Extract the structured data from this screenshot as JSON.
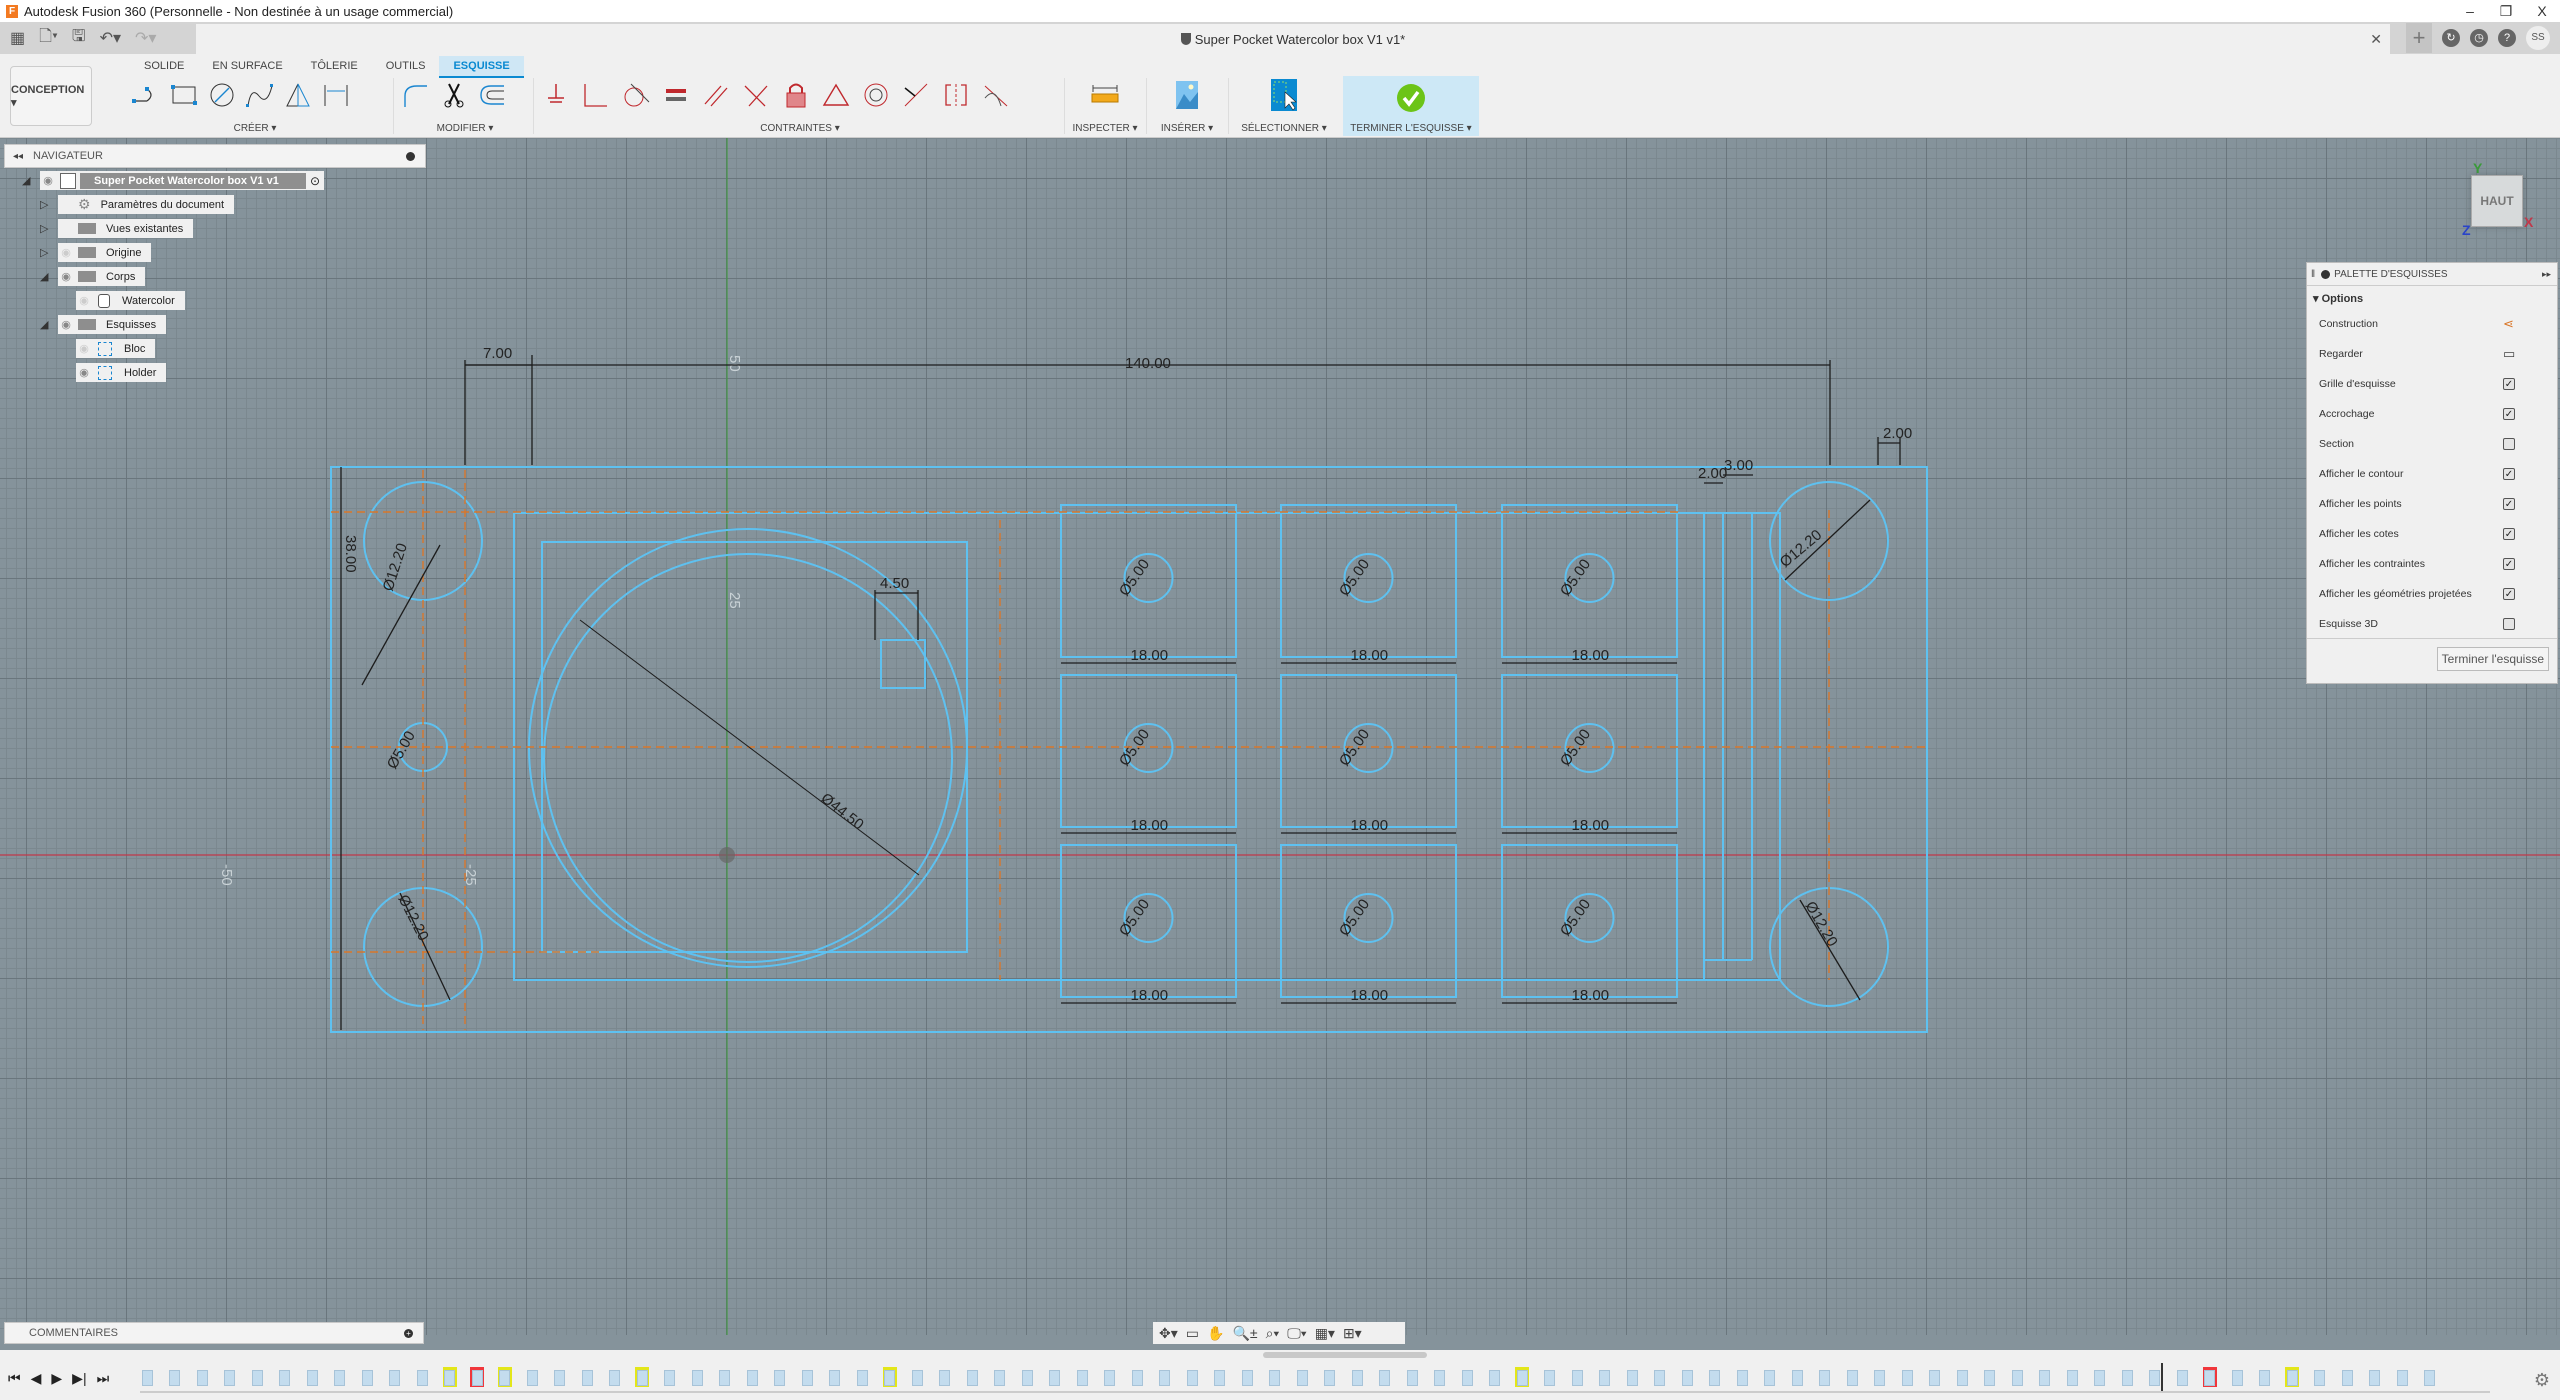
{
  "window": {
    "app_title": "Autodesk Fusion 360 (Personnelle - Non destinée à un usage commercial)",
    "doc_tab_title": "Super Pocket Watercolor box V1 v1*",
    "controls": {
      "minimize": "–",
      "maximize": "❐",
      "close": "X"
    },
    "avatar_initials": "SS"
  },
  "ribbon": {
    "workspace": "CONCEPTION ▾",
    "tabs": [
      {
        "label": "SOLIDE",
        "active": false
      },
      {
        "label": "EN SURFACE",
        "active": false
      },
      {
        "label": "TÔLERIE",
        "active": false
      },
      {
        "label": "OUTILS",
        "active": false
      },
      {
        "label": "ESQUISSE",
        "active": true
      }
    ],
    "groups": {
      "create": "CRÉER ▾",
      "modify": "MODIFIER ▾",
      "constraints": "CONTRAINTES ▾",
      "inspect": "INSPECTER ▾",
      "insert": "INSÉRER ▾",
      "select": "SÉLECTIONNER ▾",
      "finish": "TERMINER L'ESQUISSE ▾"
    }
  },
  "navigator": {
    "title": "NAVIGATEUR",
    "root": "Super Pocket Watercolor box V1 v1",
    "items": [
      {
        "label": "Paramètres du document",
        "level": 1,
        "expand": "collapsed",
        "visible": null,
        "icon": "gear-icon"
      },
      {
        "label": "Vues existantes",
        "level": 1,
        "expand": "collapsed",
        "visible": null,
        "icon": "folder-icon"
      },
      {
        "label": "Origine",
        "level": 1,
        "expand": "collapsed",
        "visible": false,
        "icon": "folder-icon"
      },
      {
        "label": "Corps",
        "level": 1,
        "expand": "expanded",
        "visible": true,
        "icon": "folder-icon"
      },
      {
        "label": "Watercolor",
        "level": 2,
        "expand": null,
        "visible": false,
        "icon": "body-icon"
      },
      {
        "label": "Esquisses",
        "level": 1,
        "expand": "expanded",
        "visible": true,
        "icon": "folder-icon"
      },
      {
        "label": "Bloc",
        "level": 2,
        "expand": null,
        "visible": false,
        "icon": "sketch-icon"
      },
      {
        "label": "Holder",
        "level": 2,
        "expand": null,
        "visible": true,
        "icon": "sketch-icon"
      }
    ]
  },
  "palette": {
    "title": "PALETTE D'ESQUISSES",
    "section": "Options",
    "options": [
      {
        "label": "Construction",
        "type": "icon",
        "icon": "construction-icon"
      },
      {
        "label": "Regarder",
        "type": "icon",
        "icon": "look-at-icon"
      },
      {
        "label": "Grille d'esquisse",
        "type": "checkbox",
        "checked": true
      },
      {
        "label": "Accrochage",
        "type": "checkbox",
        "checked": true
      },
      {
        "label": "Section",
        "type": "checkbox",
        "checked": false
      },
      {
        "label": "Afficher le contour",
        "type": "checkbox",
        "checked": true
      },
      {
        "label": "Afficher les points",
        "type": "checkbox",
        "checked": true
      },
      {
        "label": "Afficher les cotes",
        "type": "checkbox",
        "checked": true
      },
      {
        "label": "Afficher les contraintes",
        "type": "checkbox",
        "checked": true
      },
      {
        "label": "Afficher les géométries projetées",
        "type": "checkbox",
        "checked": true
      },
      {
        "label": "Esquisse 3D",
        "type": "checkbox",
        "checked": false
      }
    ],
    "finish_button": "Terminer l'esquisse"
  },
  "viewcube": {
    "face": "HAUT",
    "axes": {
      "x": "X",
      "y": "Y",
      "z": "Z"
    }
  },
  "sketch": {
    "dimensions": {
      "overall_length": "140.00",
      "left_offset": "7.00",
      "height": "38.00",
      "corner_hole_dia": "Ø12.20",
      "small_hole_dia": "Ø5.00",
      "big_circle_dia": "Ø44.50",
      "slot_width": "4.50",
      "cell_width": "18.00",
      "right_gap_1": "2.00",
      "right_gap_2": "3.00",
      "right_edge": "2.00"
    },
    "grid_labels": {
      "y50": "50",
      "y25": "25",
      "x_neg50": "-50",
      "x_neg25": "-25"
    }
  },
  "comments": {
    "title": "COMMENTAIRES"
  },
  "timeline": {
    "controls": [
      "first",
      "previous",
      "play",
      "next",
      "last"
    ],
    "markers": {
      "highlighted_yellow": 7,
      "error_red": 2
    }
  },
  "colors": {
    "accent": "#0a8ad1",
    "sketch_line": "#5ec1f0",
    "construction": "#d9772a",
    "canvas": "#85939b",
    "finish_check": "#6cc417"
  }
}
